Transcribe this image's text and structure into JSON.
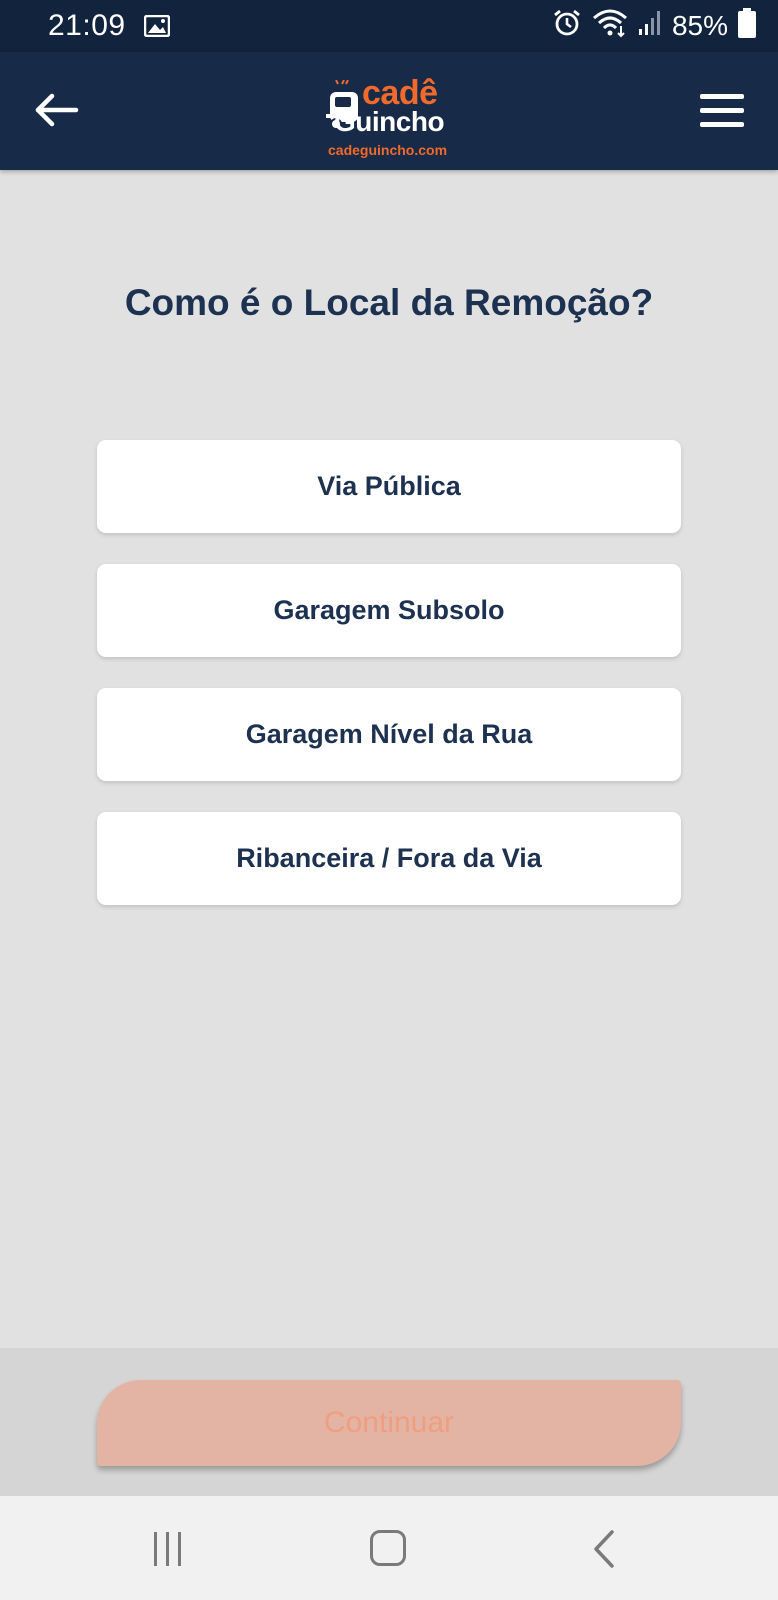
{
  "status_bar": {
    "time": "21:09",
    "battery": "85%",
    "icons": [
      "gallery-icon",
      "alarm-icon",
      "wifi-icon",
      "signal-icon",
      "battery-icon"
    ]
  },
  "header": {
    "logo_top": "cadê",
    "logo_mid": "Guincho",
    "logo_sub": "cadeguincho.com",
    "back_icon": "arrow-left-icon",
    "menu_icon": "hamburger-menu-icon"
  },
  "main": {
    "title": "Como é o Local da Remoção?",
    "options": [
      {
        "label": "Via Pública"
      },
      {
        "label": "Garagem Subsolo"
      },
      {
        "label": "Garagem Nível da Rua"
      },
      {
        "label": "Ribanceira / Fora da Via"
      }
    ]
  },
  "footer": {
    "continue_label": "Continuar",
    "continue_state": "disabled"
  },
  "nav_bar": {
    "icons": [
      "recent-apps-icon",
      "home-icon",
      "back-icon"
    ]
  },
  "colors": {
    "header_bg": "#172a47",
    "status_bg": "#12233d",
    "brand_orange": "#f06a2b",
    "text_dark": "#1d3150",
    "page_bg": "#e1e1e1",
    "continue_bg": "#e3b4a3"
  }
}
